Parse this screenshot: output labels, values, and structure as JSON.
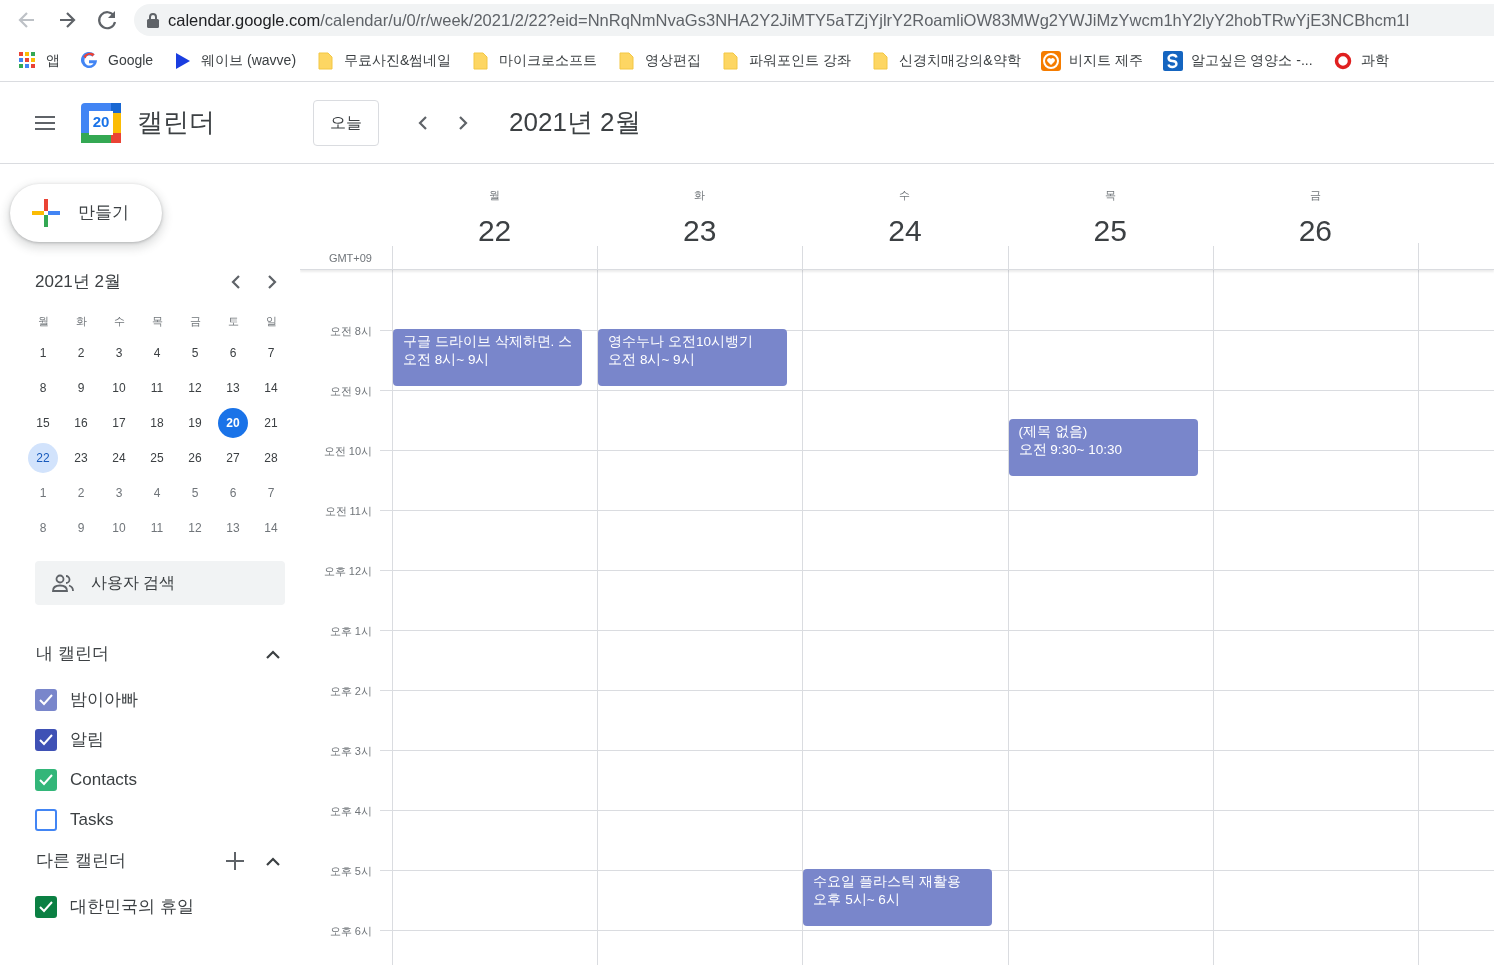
{
  "browser": {
    "back": {
      "disabled": true
    },
    "forward": {
      "disabled": false
    },
    "url_host": "calendar.google.com",
    "url_path": "/calendar/u/0/r/week/2021/2/22?eid=NnRqNmNvaGs3NHA2Y2JiMTY5aTZjYjlrY2RoamliOW83MWg2YWJiMzYwcm1hY2lyY2hobTRwYjE3NCBhcm1l"
  },
  "bookmarks": [
    {
      "kind": "apps",
      "label": "앱"
    },
    {
      "kind": "google",
      "label": "Google"
    },
    {
      "kind": "play",
      "label": "웨이브 (wavve)"
    },
    {
      "kind": "folder",
      "label": "무료사진&썸네일"
    },
    {
      "kind": "folder",
      "label": "마이크로소프트"
    },
    {
      "kind": "folder",
      "label": "영상편집"
    },
    {
      "kind": "folder",
      "label": "파워포인트 강좌"
    },
    {
      "kind": "folder",
      "label": "신경치매강의&약학"
    },
    {
      "kind": "heart",
      "label": "비지트 제주"
    },
    {
      "kind": "letter",
      "label": "알고싶은 영양소 -..."
    },
    {
      "kind": "ring",
      "label": "과학"
    }
  ],
  "header": {
    "logo_day": "20",
    "app_name": "캘린더",
    "today_button": "오늘",
    "title": "2021년 2월"
  },
  "create_button": "만들기",
  "mini_calendar": {
    "title": "2021년 2월",
    "weekdays": [
      "월",
      "화",
      "수",
      "목",
      "금",
      "토",
      "일"
    ],
    "weeks": [
      [
        {
          "day": "1",
          "outside": false,
          "today": false,
          "selected": false
        },
        {
          "day": "2",
          "outside": false,
          "today": false,
          "selected": false
        },
        {
          "day": "3",
          "outside": false,
          "today": false,
          "selected": false
        },
        {
          "day": "4",
          "outside": false,
          "today": false,
          "selected": false
        },
        {
          "day": "5",
          "outside": false,
          "today": false,
          "selected": false
        },
        {
          "day": "6",
          "outside": false,
          "today": false,
          "selected": false
        },
        {
          "day": "7",
          "outside": false,
          "today": false,
          "selected": false
        }
      ],
      [
        {
          "day": "8",
          "outside": false,
          "today": false,
          "selected": false
        },
        {
          "day": "9",
          "outside": false,
          "today": false,
          "selected": false
        },
        {
          "day": "10",
          "outside": false,
          "today": false,
          "selected": false
        },
        {
          "day": "11",
          "outside": false,
          "today": false,
          "selected": false
        },
        {
          "day": "12",
          "outside": false,
          "today": false,
          "selected": false
        },
        {
          "day": "13",
          "outside": false,
          "today": false,
          "selected": false
        },
        {
          "day": "14",
          "outside": false,
          "today": false,
          "selected": false
        }
      ],
      [
        {
          "day": "15",
          "outside": false,
          "today": false,
          "selected": false
        },
        {
          "day": "16",
          "outside": false,
          "today": false,
          "selected": false
        },
        {
          "day": "17",
          "outside": false,
          "today": false,
          "selected": false
        },
        {
          "day": "18",
          "outside": false,
          "today": false,
          "selected": false
        },
        {
          "day": "19",
          "outside": false,
          "today": false,
          "selected": false
        },
        {
          "day": "20",
          "outside": false,
          "today": true,
          "selected": false
        },
        {
          "day": "21",
          "outside": false,
          "today": false,
          "selected": false
        }
      ],
      [
        {
          "day": "22",
          "outside": false,
          "today": false,
          "selected": true
        },
        {
          "day": "23",
          "outside": false,
          "today": false,
          "selected": false
        },
        {
          "day": "24",
          "outside": false,
          "today": false,
          "selected": false
        },
        {
          "day": "25",
          "outside": false,
          "today": false,
          "selected": false
        },
        {
          "day": "26",
          "outside": false,
          "today": false,
          "selected": false
        },
        {
          "day": "27",
          "outside": false,
          "today": false,
          "selected": false
        },
        {
          "day": "28",
          "outside": false,
          "today": false,
          "selected": false
        }
      ],
      [
        {
          "day": "1",
          "outside": true,
          "today": false,
          "selected": false
        },
        {
          "day": "2",
          "outside": true,
          "today": false,
          "selected": false
        },
        {
          "day": "3",
          "outside": true,
          "today": false,
          "selected": false
        },
        {
          "day": "4",
          "outside": true,
          "today": false,
          "selected": false
        },
        {
          "day": "5",
          "outside": true,
          "today": false,
          "selected": false
        },
        {
          "day": "6",
          "outside": true,
          "today": false,
          "selected": false
        },
        {
          "day": "7",
          "outside": true,
          "today": false,
          "selected": false
        }
      ],
      [
        {
          "day": "8",
          "outside": true,
          "today": false,
          "selected": false
        },
        {
          "day": "9",
          "outside": true,
          "today": false,
          "selected": false
        },
        {
          "day": "10",
          "outside": true,
          "today": false,
          "selected": false
        },
        {
          "day": "11",
          "outside": true,
          "today": false,
          "selected": false
        },
        {
          "day": "12",
          "outside": true,
          "today": false,
          "selected": false
        },
        {
          "day": "13",
          "outside": true,
          "today": false,
          "selected": false
        },
        {
          "day": "14",
          "outside": true,
          "today": false,
          "selected": false
        }
      ]
    ]
  },
  "people_search": {
    "placeholder": "사용자 검색"
  },
  "my_calendars": {
    "title": "내 캘린더",
    "expanded": true,
    "items": [
      {
        "label": "밤이아빠",
        "checked": true,
        "color": "#7986cb"
      },
      {
        "label": "알림",
        "checked": true,
        "color": "#3f51b5"
      },
      {
        "label": "Contacts",
        "checked": true,
        "color": "#33b679"
      },
      {
        "label": "Tasks",
        "checked": false,
        "color": "#4285f4"
      }
    ]
  },
  "other_calendars": {
    "title": "다른 캘린더",
    "expanded": true,
    "items": [
      {
        "label": "대한민국의 휴일",
        "checked": true,
        "color": "#0b8043"
      }
    ]
  },
  "week": {
    "timezone": "GMT+09",
    "hours": [
      "오전 8시",
      "오전 9시",
      "오전 10시",
      "오전 11시",
      "오후 12시",
      "오후 1시",
      "오후 2시",
      "오후 3시",
      "오후 4시",
      "오후 5시",
      "오후 6시"
    ],
    "days": [
      {
        "weekday": "월",
        "date": "22",
        "events": [
          {
            "title": "구글 드라이브 삭제하면. 스",
            "time": "오전 8시~ 9시"
          }
        ]
      },
      {
        "weekday": "화",
        "date": "23",
        "events": [
          {
            "title": "영수누나 오전10시뱅기",
            "time": "오전 8시~ 9시"
          }
        ]
      },
      {
        "weekday": "수",
        "date": "24",
        "events": [
          {
            "title": "수요일 플라스틱 재활용",
            "time": "오후 5시~ 6시"
          }
        ]
      },
      {
        "weekday": "목",
        "date": "25",
        "events": [
          {
            "title": "(제목 없음)",
            "time": "오전 9:30~ 10:30"
          }
        ]
      },
      {
        "weekday": "금",
        "date": "26"
      }
    ]
  }
}
